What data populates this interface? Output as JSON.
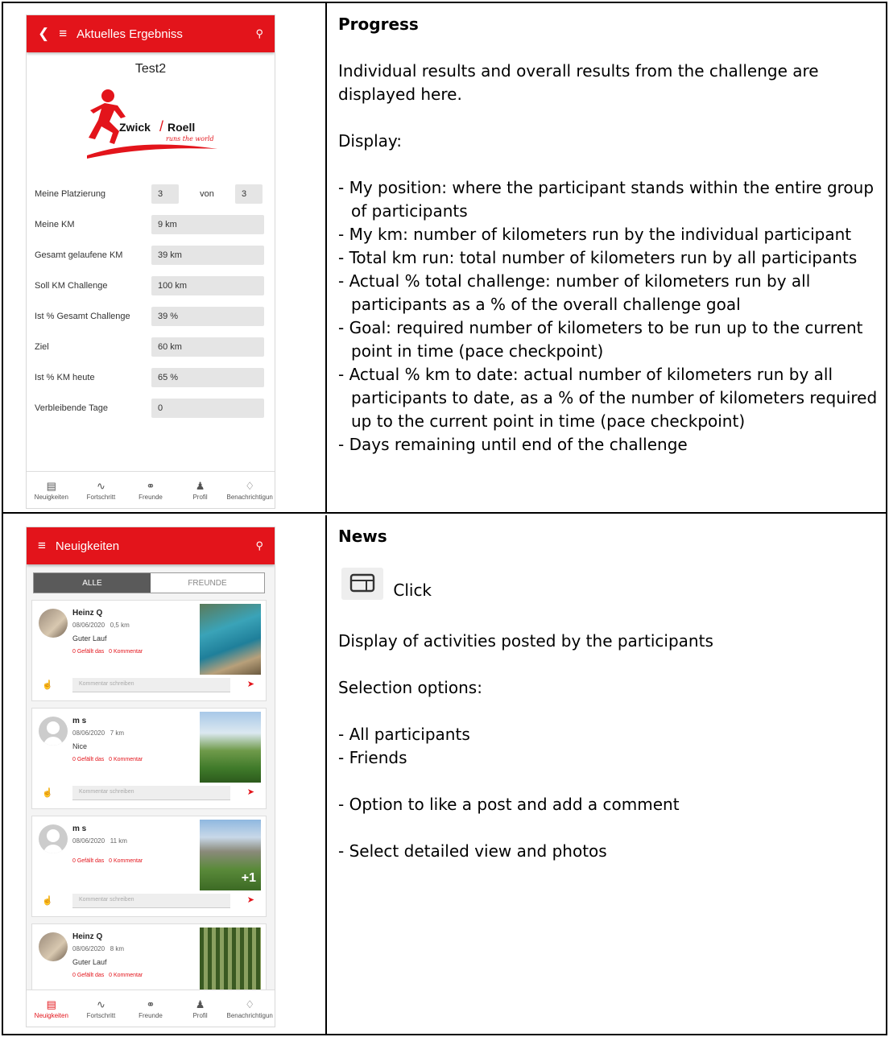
{
  "progress": {
    "heading": "Progress",
    "intro": "Individual results and overall results from the challenge are displayed here.",
    "display_label": "Display:",
    "items": [
      "- My position: where the participant stands within the entire group of participants",
      "- My km: number of kilometers run by the individual participant",
      "- Total km run: total number of kilometers run by all participants",
      "- Actual % total challenge: number of kilometers run by all participants as a % of the overall challenge goal",
      "- Goal: required number of kilometers to be run up to the current point in time (pace checkpoint)",
      "- Actual % km to date: actual number of kilometers run by all participants to date, as a % of the number of kilometers required up to the current point in time (pace checkpoint)",
      "- Days remaining until end of the challenge"
    ]
  },
  "news": {
    "heading": "News",
    "click_label": "Click",
    "intro": "Display of activities posted by the participants",
    "selection_label": "Selection options:",
    "options": [
      "- All participants",
      "- Friends"
    ],
    "like_note": "- Option to like a post and add a comment",
    "detail_note": "- Select detailed view and photos"
  },
  "phone1": {
    "appbar_title": "Aktuelles Ergebniss",
    "challenge_name": "Test2",
    "logo_text_1": "Zwick",
    "logo_text_2": "Roell",
    "logo_slogan": "runs the world",
    "rows": {
      "placement": {
        "label": "Meine Platzierung",
        "value": "3",
        "von": "von",
        "total": "3"
      },
      "my_km": {
        "label": "Meine KM",
        "value": "9 km"
      },
      "total_km": {
        "label": "Gesamt gelaufene KM",
        "value": "39 km"
      },
      "target_km": {
        "label": "Soll KM Challenge",
        "value": "100 km"
      },
      "pct_total": {
        "label": "Ist % Gesamt Challenge",
        "value": "39 %"
      },
      "goal": {
        "label": "Ziel",
        "value": "60 km"
      },
      "pct_today": {
        "label": "Ist % KM heute",
        "value": "65 %"
      },
      "days_left": {
        "label": "Verbleibende Tage",
        "value": "0"
      }
    }
  },
  "phone2": {
    "appbar_title": "Neuigkeiten",
    "tabs": [
      "ALLE",
      "FREUNDE"
    ],
    "comment_placeholder": "Kommentar schreiben",
    "posts": [
      {
        "name": "Heinz Q",
        "date": "08/06/2020",
        "distance": "0,5 km",
        "text": "Guter Lauf",
        "likes": "0 Gefällt das",
        "comments": "0 Kommentar"
      },
      {
        "name": "m s",
        "date": "08/06/2020",
        "distance": "7 km",
        "text": "Nice",
        "likes": "0 Gefällt das",
        "comments": "0 Kommentar"
      },
      {
        "name": "m s",
        "date": "08/06/2020",
        "distance": "11 km",
        "text": "",
        "likes": "0 Gefällt das",
        "comments": "0 Kommentar",
        "extra_photos": "+1"
      },
      {
        "name": "Heinz Q",
        "date": "08/06/2020",
        "distance": "8 km",
        "text": "Guter Lauf",
        "likes": "0 Gefällt das",
        "comments": "0 Kommentar"
      }
    ]
  },
  "navbar": [
    "Neuigkeiten",
    "Fortschritt",
    "Freunde",
    "Profil",
    "Benachrichtigun"
  ],
  "icons": {
    "back": "back-arrow-icon",
    "menu": "menu-icon",
    "search": "search-icon",
    "news": "news-icon",
    "progress": "progress-icon",
    "friends": "friends-icon",
    "profile": "profile-icon",
    "notifications": "bell-icon"
  },
  "colors": {
    "brand_red": "#e3141b",
    "tab_active": "#5a5a5a"
  }
}
